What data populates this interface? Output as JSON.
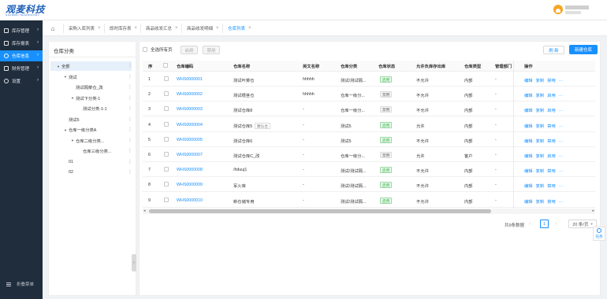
{
  "brand": {
    "name": "观麦科技",
    "sub": "GUANMAI TECHNOLOGY"
  },
  "sidebar": {
    "items": [
      {
        "label": "库存管理",
        "icon": "box-icon"
      },
      {
        "label": "库存报表",
        "icon": "report-icon"
      },
      {
        "label": "仓库信息",
        "icon": "warehouse-icon"
      },
      {
        "label": "财务管理",
        "icon": "finance-icon"
      },
      {
        "label": "设置",
        "icon": "gear-icon"
      }
    ],
    "collapse_label": "折叠菜单"
  },
  "tabs": [
    {
      "label": "采购入库列表"
    },
    {
      "label": "即时库存表"
    },
    {
      "label": "商品收发汇总"
    },
    {
      "label": "商品收发明细"
    },
    {
      "label": "仓库列表"
    }
  ],
  "left_panel": {
    "title": "仓库分类",
    "tree": [
      {
        "label": "全部",
        "level": 0,
        "expanded": true
      },
      {
        "label": "测试",
        "level": 1,
        "expanded": true
      },
      {
        "label": "测试隔菜仓_改",
        "level": 2,
        "expanded": null
      },
      {
        "label": "测试下分类-1",
        "level": 2,
        "expanded": true
      },
      {
        "label": "测试分类-1-1",
        "level": 3,
        "expanded": null
      },
      {
        "label": "测试5",
        "level": 1,
        "expanded": null
      },
      {
        "label": "仓库一级分类A",
        "level": 1,
        "expanded": true
      },
      {
        "label": "仓库二级分类...",
        "level": 2,
        "expanded": true
      },
      {
        "label": "仓库三级分类...",
        "level": 3,
        "expanded": null
      },
      {
        "label": "01",
        "level": 1,
        "expanded": null
      },
      {
        "label": "02",
        "level": 1,
        "expanded": null
      }
    ]
  },
  "toolbar": {
    "select_all_page": "全选所有页",
    "enable": "启用",
    "disable": "禁用",
    "refresh": "刷 新",
    "new_warehouse": "新建仓库"
  },
  "table": {
    "columns": [
      "序",
      "",
      "仓库编码",
      "仓库名称",
      "英文名称",
      "仓库分类",
      "仓库状态",
      "允许负库存出库",
      "仓库类型",
      "管理部门",
      "操作"
    ],
    "rows": [
      {
        "idx": "1",
        "code": "WHS0000001",
        "name": "测试叶菜仓",
        "tag": "",
        "en": "hhhhh",
        "cat": "测试/测试隔...",
        "status": "启用",
        "status_on": true,
        "neg": "不允许",
        "type": "内部",
        "dept": "-",
        "toggle": "禁用"
      },
      {
        "idx": "2",
        "code": "WHS0000002",
        "name": "测试根茎仓",
        "tag": "",
        "en": "hhhhh",
        "cat": "仓库一级分...",
        "status": "禁用",
        "status_on": false,
        "neg": "不允许",
        "type": "内部",
        "dept": "-",
        "toggle": "启用"
      },
      {
        "idx": "3",
        "code": "WHS0000003",
        "name": "测试仓库8",
        "tag": "",
        "en": "-",
        "cat": "仓库一级分...",
        "status": "禁用",
        "status_on": false,
        "neg": "不允许",
        "type": "内部",
        "dept": "-",
        "toggle": "启用"
      },
      {
        "idx": "4",
        "code": "WHS0000004",
        "name": "测试仓库5",
        "tag": "默认仓",
        "en": "-",
        "cat": "测试5",
        "status": "启用",
        "status_on": true,
        "neg": "允许",
        "type": "内部",
        "dept": "-",
        "toggle": "禁用"
      },
      {
        "idx": "5",
        "code": "WHS0000005",
        "name": "测试仓库6",
        "tag": "",
        "en": "-",
        "cat": "测试5",
        "status": "启用",
        "status_on": true,
        "neg": "不允许",
        "type": "内部",
        "dept": "-",
        "toggle": "禁用"
      },
      {
        "idx": "6",
        "code": "WHS0000007",
        "name": "测试仓库C_改",
        "tag": "",
        "en": "-",
        "cat": "仓库一级分...",
        "status": "禁用",
        "status_on": false,
        "neg": "允许",
        "type": "客户",
        "dept": "-",
        "toggle": "启用"
      },
      {
        "idx": "7",
        "code": "WHS0000008",
        "name": "/hduuj1",
        "tag": "",
        "en": "-",
        "cat": "测试/测试隔...",
        "status": "启用",
        "status_on": true,
        "neg": "不允许",
        "type": "内部",
        "dept": "-",
        "toggle": "禁用"
      },
      {
        "idx": "8",
        "code": "WHS0000009",
        "name": "军火库",
        "tag": "",
        "en": "-",
        "cat": "测试/测试隔...",
        "status": "启用",
        "status_on": true,
        "neg": "不允许",
        "type": "内部",
        "dept": "-",
        "toggle": "禁用"
      },
      {
        "idx": "9",
        "code": "WHS0000010",
        "name": "新仓储专用",
        "tag": "",
        "en": "-",
        "cat": "测试/测试隔...",
        "status": "启用",
        "status_on": true,
        "neg": "不允许",
        "type": "内部",
        "dept": "-",
        "toggle": "禁用"
      }
    ],
    "op_edit": "编辑",
    "op_copy": "复制",
    "op_more": "···"
  },
  "pagination": {
    "total": "共9条数据",
    "current": "1",
    "page_size": "20 条/页"
  },
  "float_task": "任务",
  "colors": {
    "primary": "#1890ff",
    "sidebar": "#1f2d3d",
    "enabled": "#3cb34a"
  }
}
